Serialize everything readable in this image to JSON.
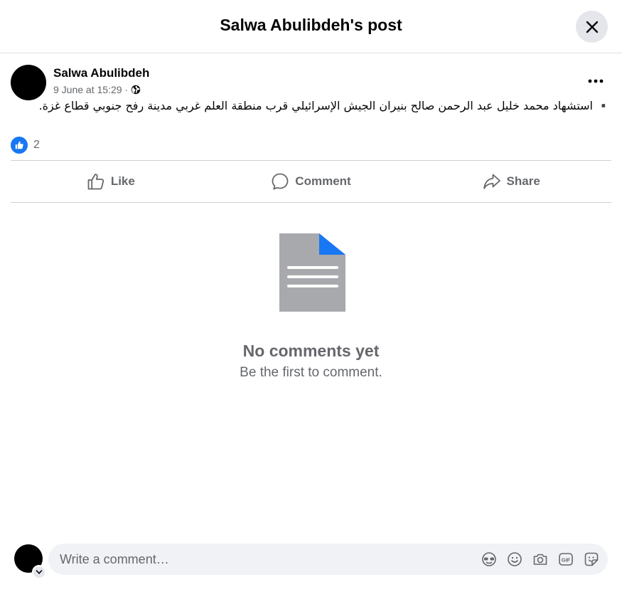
{
  "header": {
    "title": "Salwa Abulibdeh's post"
  },
  "post": {
    "author": "Salwa Abulibdeh",
    "timestamp": "9 June at 15:29 ·",
    "text": "▪️ استشهاد محمد خليل عبد الرحمن صالح بنيران الجيش الإسرائيلي قرب منطقة العلم غربي مدينة رفح جنوبي قطاع غزة.",
    "reaction_count": "2"
  },
  "actions": {
    "like": "Like",
    "comment": "Comment",
    "share": "Share"
  },
  "empty_state": {
    "title": "No comments yet",
    "subtitle": "Be the first to comment."
  },
  "composer": {
    "placeholder": "Write a comment…"
  },
  "colors": {
    "accent": "#1877f2",
    "secondary_text": "#65676b",
    "button_bg": "#e4e6eb"
  }
}
